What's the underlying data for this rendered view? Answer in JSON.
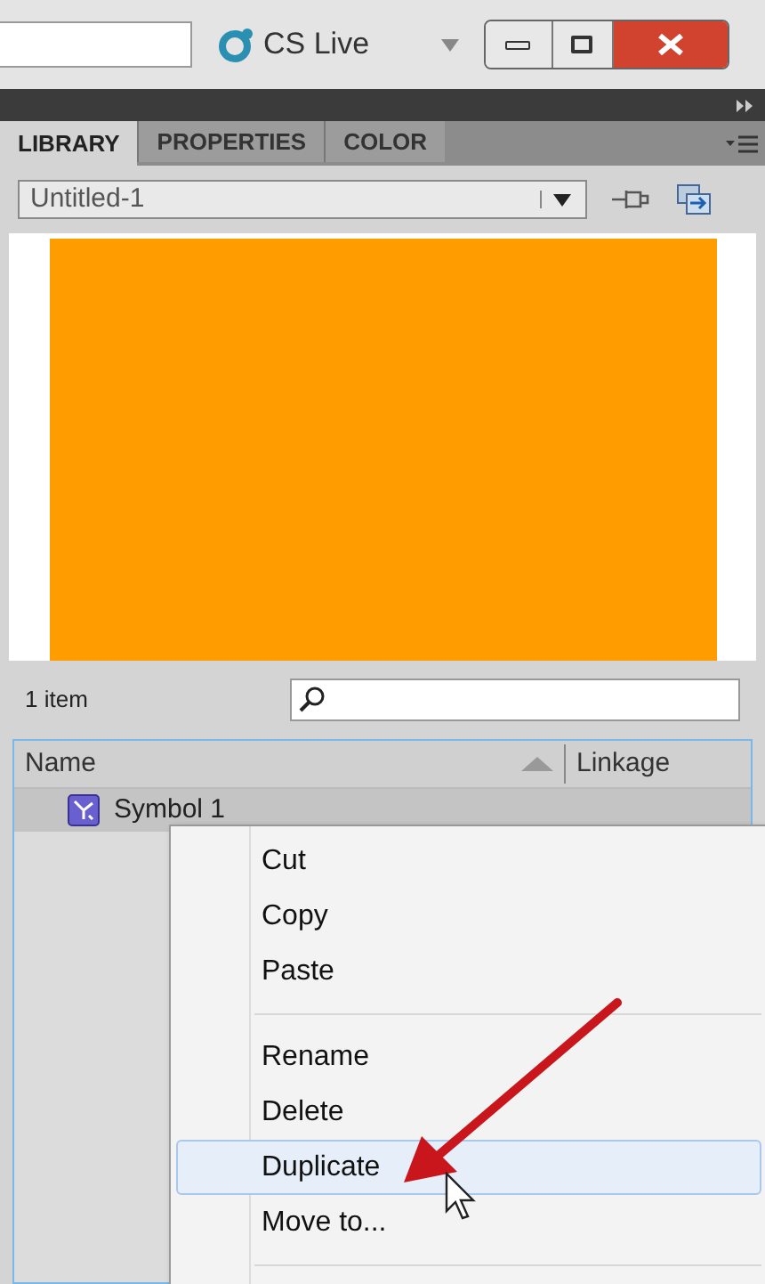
{
  "top_bar": {
    "cs_live": "CS Live"
  },
  "tabs": [
    {
      "label": "LIBRARY",
      "selected": true
    },
    {
      "label": "PROPERTIES",
      "selected": false
    },
    {
      "label": "COLOR",
      "selected": false
    }
  ],
  "document_select": {
    "value": "Untitled-1"
  },
  "library": {
    "count": "1 item",
    "columns": [
      "Name",
      "Linkage"
    ],
    "items": [
      {
        "name": "Symbol 1",
        "selected": true
      }
    ]
  },
  "context_menu": {
    "groups": [
      [
        {
          "label": "Cut",
          "selected": false
        },
        {
          "label": "Copy",
          "selected": false
        },
        {
          "label": "Paste",
          "selected": false
        }
      ],
      [
        {
          "label": "Rename",
          "selected": false
        },
        {
          "label": "Delete",
          "selected": false
        },
        {
          "label": "Duplicate",
          "selected": true
        },
        {
          "label": "Move to...",
          "selected": false
        }
      ]
    ]
  }
}
